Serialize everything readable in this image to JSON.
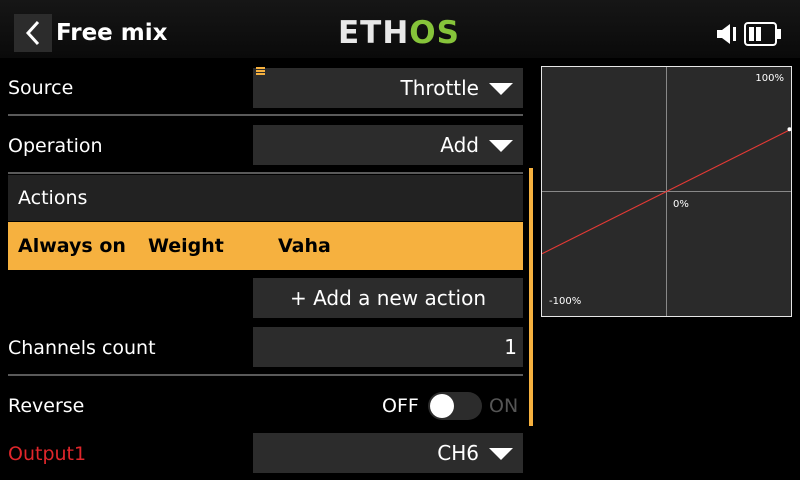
{
  "header": {
    "title": "Free mix",
    "logo_part1": "ETH",
    "logo_part2": "OS"
  },
  "icons": {
    "back": "chevron-left-icon",
    "speaker": "speaker-icon",
    "battery": "battery-icon",
    "menu": "menu-icon"
  },
  "colors": {
    "accent": "#f6b13f",
    "logo_green": "#86c43a",
    "curve": "#e53935",
    "output_label": "#e0262b"
  },
  "source": {
    "label": "Source",
    "value": "Throttle"
  },
  "operation": {
    "label": "Operation",
    "value": "Add"
  },
  "actions": {
    "title": "Actions",
    "row": {
      "condition": "Always on",
      "type": "Weight",
      "value": "Vaha"
    },
    "add_label": "+ Add a new action"
  },
  "channels": {
    "label": "Channels count",
    "value": "1"
  },
  "reverse": {
    "label": "Reverse",
    "off": "OFF",
    "on": "ON",
    "state": false
  },
  "output": {
    "label": "Output1",
    "value": "CH6"
  },
  "graph": {
    "top_label": "100%",
    "mid_label": "0%",
    "bottom_label": "-100%",
    "curve": {
      "x": [
        -100,
        100
      ],
      "y": [
        -50,
        50
      ]
    }
  }
}
